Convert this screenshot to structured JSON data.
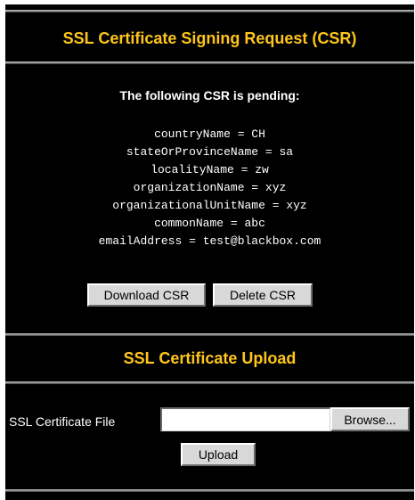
{
  "csr_section": {
    "title": "SSL Certificate Signing Request (CSR)",
    "pending_heading": "The following CSR is pending:",
    "fields": [
      "countryName = CH",
      "stateOrProvinceName = sa",
      "localityName = zw",
      "organizationName = xyz",
      "organizationalUnitName = xyz",
      "commonName = abc",
      "emailAddress = test@blackbox.com"
    ],
    "download_label": "Download CSR",
    "delete_label": "Delete CSR"
  },
  "upload_section": {
    "title": "SSL Certificate Upload",
    "file_label": "SSL Certificate File",
    "file_value": "",
    "browse_label": "Browse...",
    "upload_label": "Upload"
  },
  "colors": {
    "background": "#000000",
    "title": "#ffc51a",
    "text": "#ffffff",
    "button": "#d8d8d8"
  }
}
